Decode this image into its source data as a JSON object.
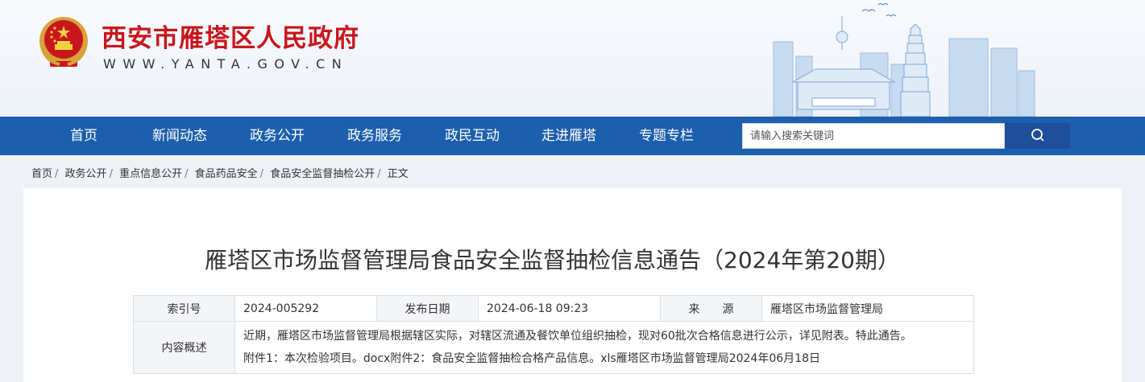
{
  "header": {
    "site_title": "西安市雁塔区人民政府",
    "site_url": "WWW.YANTA.GOV.CN",
    "brand_color": "#c8161d"
  },
  "nav": {
    "items": [
      {
        "label": "首页"
      },
      {
        "label": "新闻动态"
      },
      {
        "label": "政务公开"
      },
      {
        "label": "政务服务"
      },
      {
        "label": "政民互动"
      },
      {
        "label": "走进雁塔"
      },
      {
        "label": "专题专栏"
      }
    ],
    "search_placeholder": "请输入搜索关键词",
    "nav_color": "#1c5fad"
  },
  "breadcrumb": [
    {
      "label": "首页"
    },
    {
      "label": "政务公开"
    },
    {
      "label": "重点信息公开"
    },
    {
      "label": "食品药品安全"
    },
    {
      "label": "食品安全监督抽检公开"
    },
    {
      "label": "正文"
    }
  ],
  "article": {
    "title": "雁塔区市场监督管理局食品安全监督抽检信息通告（2024年第20期）",
    "meta": {
      "index_label": "索引号",
      "index_value": "2024-005292",
      "date_label": "发布日期",
      "date_value": "2024-06-18 09:23",
      "source_label": "来　　源",
      "source_value": "雁塔区市场监督管理局",
      "summary_label": "内容概述",
      "summary_line1": "近期，雁塔区市场监督管理局根据辖区实际，对辖区流通及餐饮单位组织抽检，现对60批次合格信息进行公示，详见附表。特此通告。",
      "summary_line2": "附件1：本次检验项目。docx附件2：食品安全监督抽检合格产品信息。xls雁塔区市场监督管理局2024年06月18日"
    }
  }
}
